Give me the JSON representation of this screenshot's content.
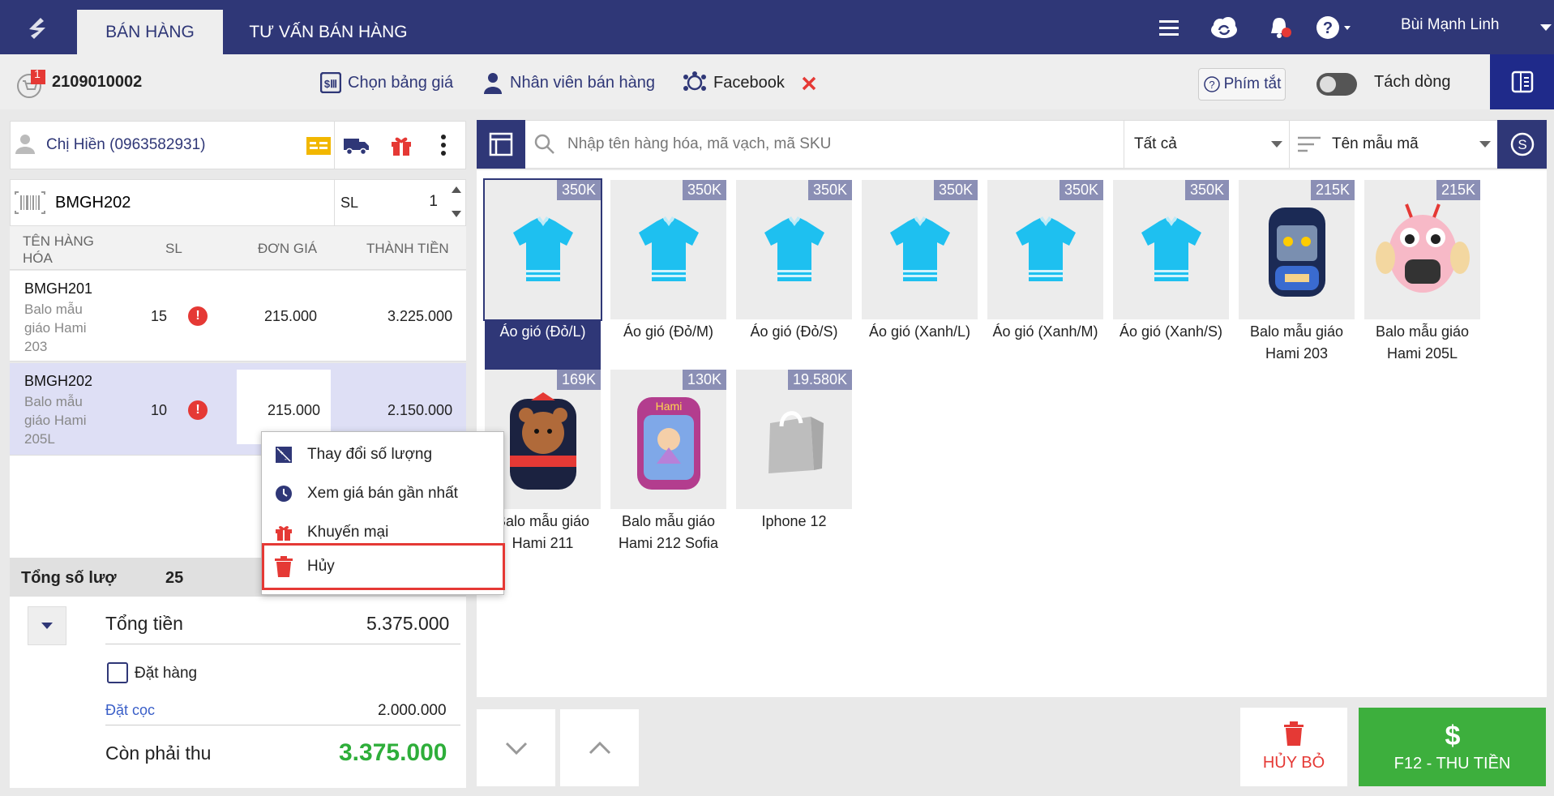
{
  "tabs": [
    {
      "label": "BÁN HÀNG"
    },
    {
      "label": "TƯ VẤN BÁN HÀNG"
    }
  ],
  "user": {
    "name": "Bùi Mạnh Linh"
  },
  "order": {
    "badge": "1",
    "code": "2109010002"
  },
  "toolbar": {
    "price_list": "Chọn bảng giá",
    "staff": "Nhân viên bán hàng",
    "source": "Facebook",
    "shortcut": "Phím tắt",
    "split_line": "Tách dòng"
  },
  "customer": {
    "name": "Chị Hiền (0963582931)"
  },
  "scan": {
    "value": "BMGH202",
    "qty_label": "SL",
    "qty": "1"
  },
  "table": {
    "headers": [
      "TÊN HÀNG HÓA",
      "SL",
      "ĐƠN GIÁ",
      "THÀNH TIỀN"
    ],
    "rows": [
      {
        "code": "BMGH201",
        "name": "Balo mẫu giáo Hami 203",
        "qty": "15",
        "price": "215.000",
        "total": "3.225.000"
      },
      {
        "code": "BMGH202",
        "name": "Balo mẫu giáo Hami 205L",
        "qty": "10",
        "price": "215.000",
        "total": "2.150.000"
      }
    ]
  },
  "context_menu": {
    "items": [
      "Thay đổi số lượng",
      "Xem giá bán gần nhất",
      "Khuyến mại",
      "Hủy"
    ]
  },
  "summary": {
    "total_qty_label": "Tổng số lượ",
    "total_qty": "25",
    "total_label": "Tổng tiền",
    "total": "5.375.000",
    "order_label": "Đặt hàng",
    "deposit_label": "Đặt cọc",
    "deposit": "2.000.000",
    "remaining_label": "Còn phải thu",
    "remaining": "3.375.000"
  },
  "search": {
    "placeholder": "Nhập tên hàng hóa, mã vạch, mã SKU",
    "filter": "Tất cả",
    "sort": "Tên mẫu mã"
  },
  "products": [
    {
      "price": "350K",
      "name": "Áo gió (Đỏ/L)",
      "kind": "shirt",
      "selected": true
    },
    {
      "price": "350K",
      "name": "Áo gió (Đỏ/M)",
      "kind": "shirt"
    },
    {
      "price": "350K",
      "name": "Áo gió (Đỏ/S)",
      "kind": "shirt"
    },
    {
      "price": "350K",
      "name": "Áo gió (Xanh/L)",
      "kind": "shirt"
    },
    {
      "price": "350K",
      "name": "Áo gió (Xanh/M)",
      "kind": "shirt"
    },
    {
      "price": "350K",
      "name": "Áo gió (Xanh/S)",
      "kind": "shirt"
    },
    {
      "price": "215K",
      "name": "Balo mẫu giáo Hami 203",
      "kind": "bag-blue"
    },
    {
      "price": "215K",
      "name": "Balo mẫu giáo Hami 205L",
      "kind": "bag-pink"
    },
    {
      "price": "169K",
      "name": "Balo mẫu giáo Hami 211",
      "kind": "bag-bear"
    },
    {
      "price": "130K",
      "name": "Balo mẫu giáo Hami 212 Sofia",
      "kind": "bag-sofia"
    },
    {
      "price": "19.580K",
      "name": "Iphone 12",
      "kind": "placeholder"
    }
  ],
  "actions": {
    "cancel": "HỦY BỎ",
    "pay": "F12 - THU TIỀN"
  },
  "colors": {
    "brand": "#2f3777",
    "danger": "#e53935",
    "success": "#3daf3d",
    "remaining": "#2eae3a"
  }
}
